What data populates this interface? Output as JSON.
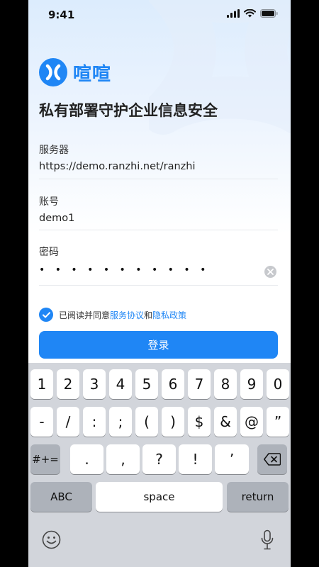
{
  "status_bar": {
    "time": "9:41"
  },
  "app": {
    "name": "喧喧",
    "slogan": "私有部署守护企业信息安全"
  },
  "form": {
    "server_label": "服务器",
    "server_value": "https://demo.ranzhi.net/ranzhi",
    "account_label": "账号",
    "account_value": "demo1",
    "password_label": "密码",
    "password_mask": "• • • • • • • • • • •"
  },
  "agreement": {
    "prefix": "已阅读并同意",
    "terms": "服务协议",
    "and": "和",
    "privacy": "隐私政策",
    "checked": true
  },
  "login_label": "登录",
  "colors": {
    "accent": "#1f86f5"
  },
  "keyboard": {
    "row1": [
      "1",
      "2",
      "3",
      "4",
      "5",
      "6",
      "7",
      "8",
      "9",
      "0"
    ],
    "row2": [
      "-",
      "/",
      ":",
      ";",
      "(",
      ")",
      "$",
      "&",
      "@",
      "”"
    ],
    "row3": [
      "#+=",
      ".",
      ",",
      "?",
      "!",
      "’"
    ],
    "abc": "ABC",
    "space": "space",
    "return": "return",
    "icons": {
      "delete": "backspace-icon",
      "emoji": "emoji-icon",
      "mic": "microphone-icon"
    }
  }
}
